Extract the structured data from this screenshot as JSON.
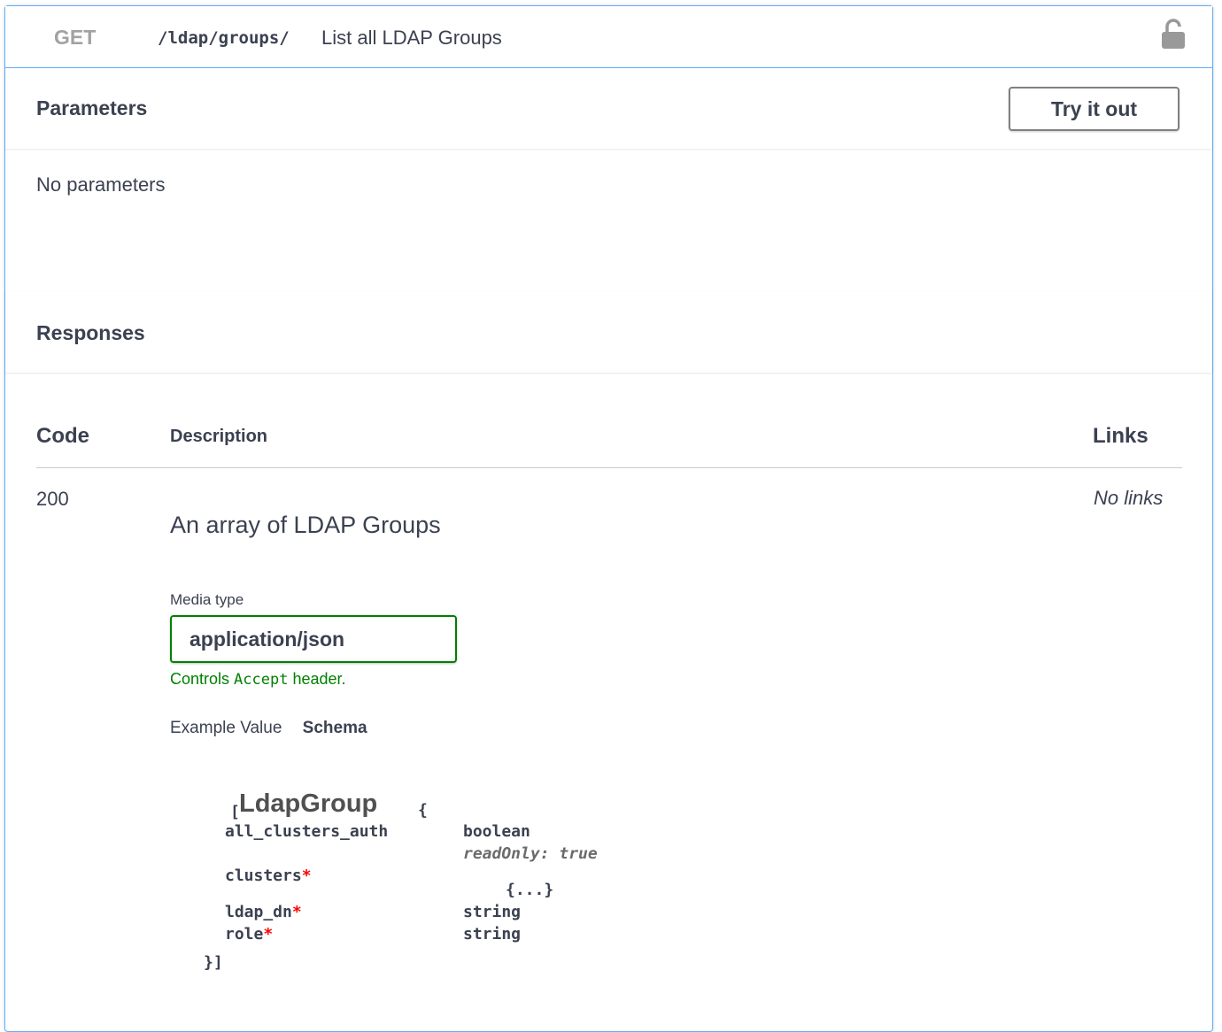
{
  "summary": {
    "method": "GET",
    "path": "/ldap/groups/",
    "description": "List all LDAP Groups",
    "lock_icon": "unlocked-lock-icon"
  },
  "parameters": {
    "title": "Parameters",
    "try_button_label": "Try it out",
    "empty_text": "No parameters"
  },
  "responses": {
    "title": "Responses",
    "columns": {
      "code": "Code",
      "description": "Description",
      "links": "Links"
    },
    "rows": [
      {
        "code": "200",
        "description": "An array of LDAP Groups",
        "links": "No links",
        "media_type_label": "Media type",
        "media_type_value": "application/json",
        "controls_prefix": "Controls",
        "controls_code": "Accept",
        "controls_suffix": "header.",
        "tabs": [
          "Example Value",
          "Schema"
        ],
        "active_tab": "Schema"
      }
    ]
  },
  "schema": {
    "open_bracket": "[",
    "model_name": "LdapGroup",
    "open_brace": "{",
    "close": "}]",
    "required_marker": "*",
    "properties": [
      {
        "name": "all_clusters_auth",
        "required": false,
        "type": "boolean",
        "note": "readOnly: true"
      },
      {
        "name": "clusters",
        "required": true,
        "type": "{...}"
      },
      {
        "name": "ldap_dn",
        "required": true,
        "type": "string"
      },
      {
        "name": "role",
        "required": true,
        "type": "string"
      }
    ]
  },
  "colors": {
    "get_border": "#61affe",
    "text": "#3b4151",
    "media_border": "#008000",
    "required": "#ff0000"
  }
}
